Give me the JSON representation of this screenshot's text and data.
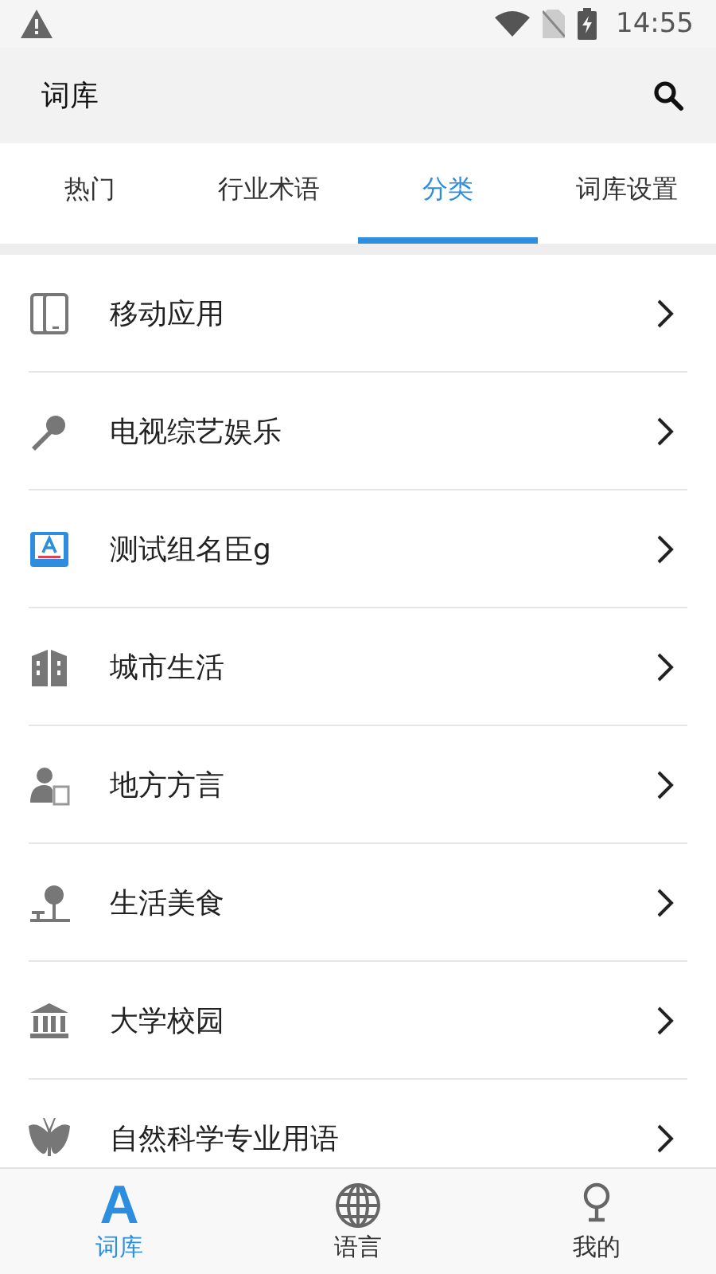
{
  "status_bar": {
    "time": "14:55"
  },
  "app_bar": {
    "title": "词库"
  },
  "tabs": [
    {
      "label": "热门",
      "selected": false
    },
    {
      "label": "行业术语",
      "selected": false
    },
    {
      "label": "分类",
      "selected": true
    },
    {
      "label": "词库设置",
      "selected": false
    }
  ],
  "categories": [
    {
      "label": "移动应用"
    },
    {
      "label": "电视综艺娱乐"
    },
    {
      "label": "测试组名臣g"
    },
    {
      "label": "城市生活"
    },
    {
      "label": "地方方言"
    },
    {
      "label": "生活美食"
    },
    {
      "label": "大学校园"
    },
    {
      "label": "自然科学专业用语"
    }
  ],
  "bottom_nav": [
    {
      "label": "词库",
      "icon_text": "A",
      "selected": true
    },
    {
      "label": "语言",
      "selected": false
    },
    {
      "label": "我的",
      "selected": false
    }
  ]
}
